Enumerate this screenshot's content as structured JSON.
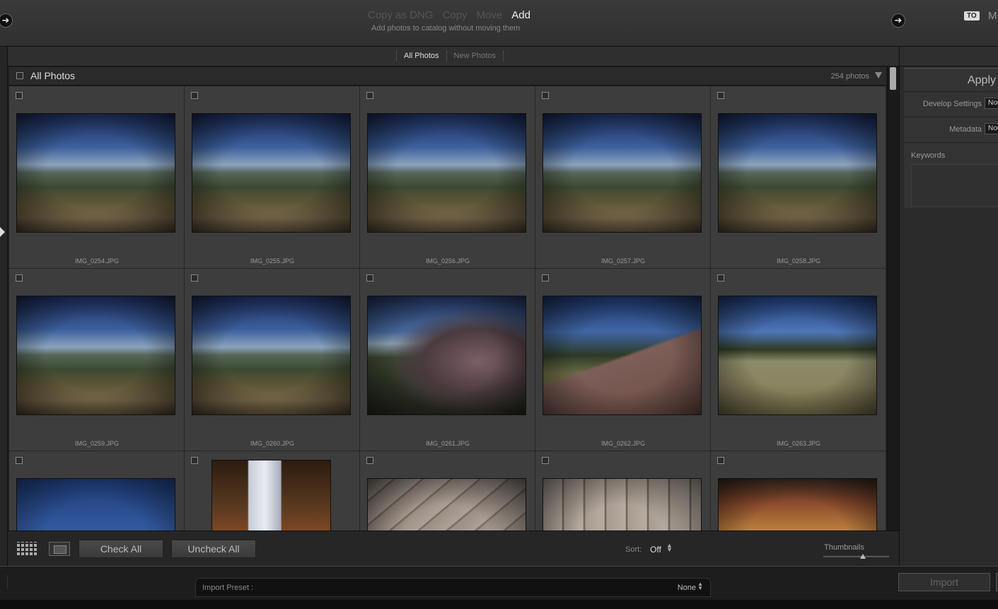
{
  "top": {
    "modes": [
      "Copy as DNG",
      "Copy",
      "Move",
      "Add"
    ],
    "active_mode": "Add",
    "mode_description": "Add photos to catalog without moving them",
    "to_badge": "TO",
    "destination_partial": "M"
  },
  "filter": {
    "tabs": [
      "All Photos",
      "New Photos"
    ],
    "active": "All Photos"
  },
  "grid": {
    "title": "All Photos",
    "count": "254 photos",
    "photos": [
      {
        "filename": "IMG_0254.JPG",
        "style": "landscape"
      },
      {
        "filename": "IMG_0255.JPG",
        "style": "landscape"
      },
      {
        "filename": "IMG_0256.JPG",
        "style": "landscape"
      },
      {
        "filename": "IMG_0257.JPG",
        "style": "landscape"
      },
      {
        "filename": "IMG_0258.JPG",
        "style": "landscape"
      },
      {
        "filename": "IMG_0259.JPG",
        "style": "landscape"
      },
      {
        "filename": "IMG_0260.JPG",
        "style": "landscape"
      },
      {
        "filename": "IMG_0261.JPG",
        "style": "garden"
      },
      {
        "filename": "IMG_0262.JPG",
        "style": "roof"
      },
      {
        "filename": "IMG_0263.JPG",
        "style": "field"
      },
      {
        "filename": "",
        "style": "sky"
      },
      {
        "filename": "",
        "style": "pillar"
      },
      {
        "filename": "",
        "style": "deck"
      },
      {
        "filename": "",
        "style": "deck2"
      },
      {
        "filename": "",
        "style": "house"
      }
    ]
  },
  "toolbar": {
    "check_all": "Check All",
    "uncheck_all": "Uncheck All",
    "sort_label": "Sort:",
    "sort_value": "Off",
    "thumbnails_label": "Thumbnails",
    "thumbnail_size": 0.6
  },
  "right_panel": {
    "apply_title": "Apply",
    "develop_settings_label": "Develop Settings",
    "develop_settings_value": "None",
    "metadata_label": "Metadata",
    "metadata_value": "None",
    "keywords_label": "Keywords"
  },
  "bottom": {
    "import_preset_label": "Import Preset :",
    "import_preset_value": "None",
    "import_button": "Import"
  },
  "icons": {
    "nav_left": "arrow-right-icon",
    "nav_right": "arrow-right-icon",
    "grid_view": "grid-view-icon",
    "loupe_view": "loupe-view-icon",
    "collapse": "triangle-down-icon"
  }
}
